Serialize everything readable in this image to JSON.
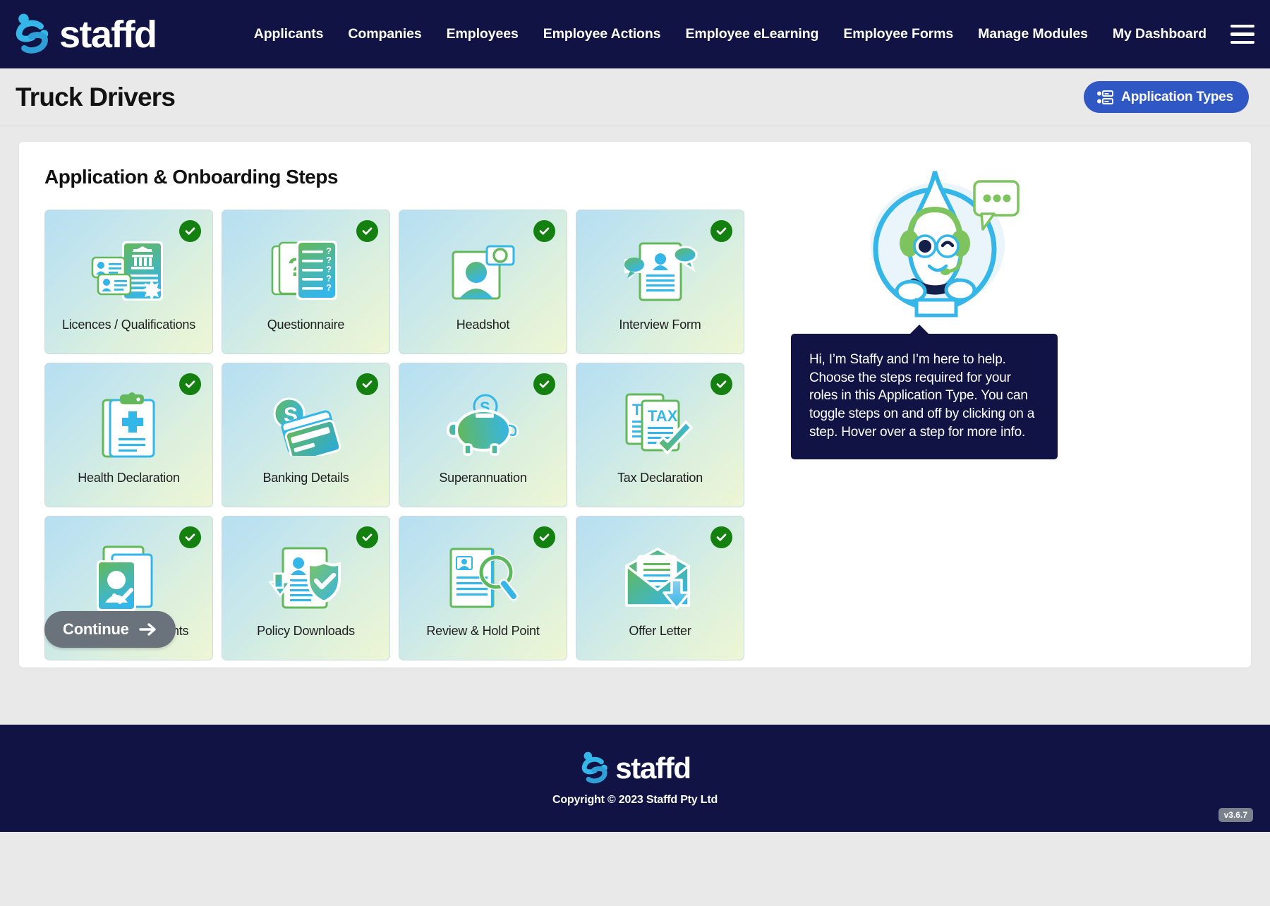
{
  "brand": {
    "name": "staffd",
    "logo_icon": "staffd-swirl-logo"
  },
  "nav": {
    "links": [
      "Applicants",
      "Companies",
      "Employees",
      "Employee Actions",
      "Employee eLearning",
      "Employee Forms",
      "Manage Modules",
      "My Dashboard"
    ],
    "menu_icon": "hamburger-menu-icon"
  },
  "header": {
    "title": "Truck Drivers",
    "application_types_label": "Application Types",
    "application_types_icon": "application-types-icon"
  },
  "panel": {
    "title": "Application & Onboarding Steps",
    "continue_label": "Continue",
    "continue_icon": "arrow-right-icon",
    "steps": [
      {
        "label": "Licences / Qualifications",
        "icon": "id-cards-certificate-icon",
        "selected": true
      },
      {
        "label": "Questionnaire",
        "icon": "question-list-icon",
        "selected": true
      },
      {
        "label": "Headshot",
        "icon": "portrait-photo-icon",
        "selected": true
      },
      {
        "label": "Interview Form",
        "icon": "speech-bubbles-form-icon",
        "selected": true
      },
      {
        "label": "Health Declaration",
        "icon": "medical-clipboard-icon",
        "selected": true
      },
      {
        "label": "Banking Details",
        "icon": "coin-credit-cards-icon",
        "selected": true
      },
      {
        "label": "Superannuation",
        "icon": "piggy-bank-icon",
        "selected": true
      },
      {
        "label": "Tax Declaration",
        "icon": "tax-documents-check-icon",
        "selected": true
      },
      {
        "label": "Fair Work Statements",
        "icon": "profile-documents-check-icon",
        "selected": true
      },
      {
        "label": "Policy Downloads",
        "icon": "document-download-shield-icon",
        "selected": true
      },
      {
        "label": "Review & Hold Point",
        "icon": "document-magnifier-icon",
        "selected": true
      },
      {
        "label": "Offer Letter",
        "icon": "envelope-download-icon",
        "selected": true
      }
    ],
    "check_icon": "check-circle-icon"
  },
  "helper": {
    "mascot_icon": "staffy-mascot-icon",
    "speech_icon": "speech-bubble-dots-icon",
    "message": "Hi, I’m Staffy and I’m here to help. Choose the steps required for your roles in this Application Type. You can toggle steps on and off by clicking on a step. Hover over a step for more info."
  },
  "footer": {
    "brand": "staffd",
    "copyright": "Copyright © 2023 Staffd Pty Ltd",
    "version": "v3.6.7"
  },
  "colors": {
    "navy": "#101344",
    "accent_blue": "#2f58c5",
    "cyan": "#35b6e8",
    "green_check": "#13800f",
    "gray_button": "#6a737c",
    "page_bg": "#e9e9ea"
  }
}
